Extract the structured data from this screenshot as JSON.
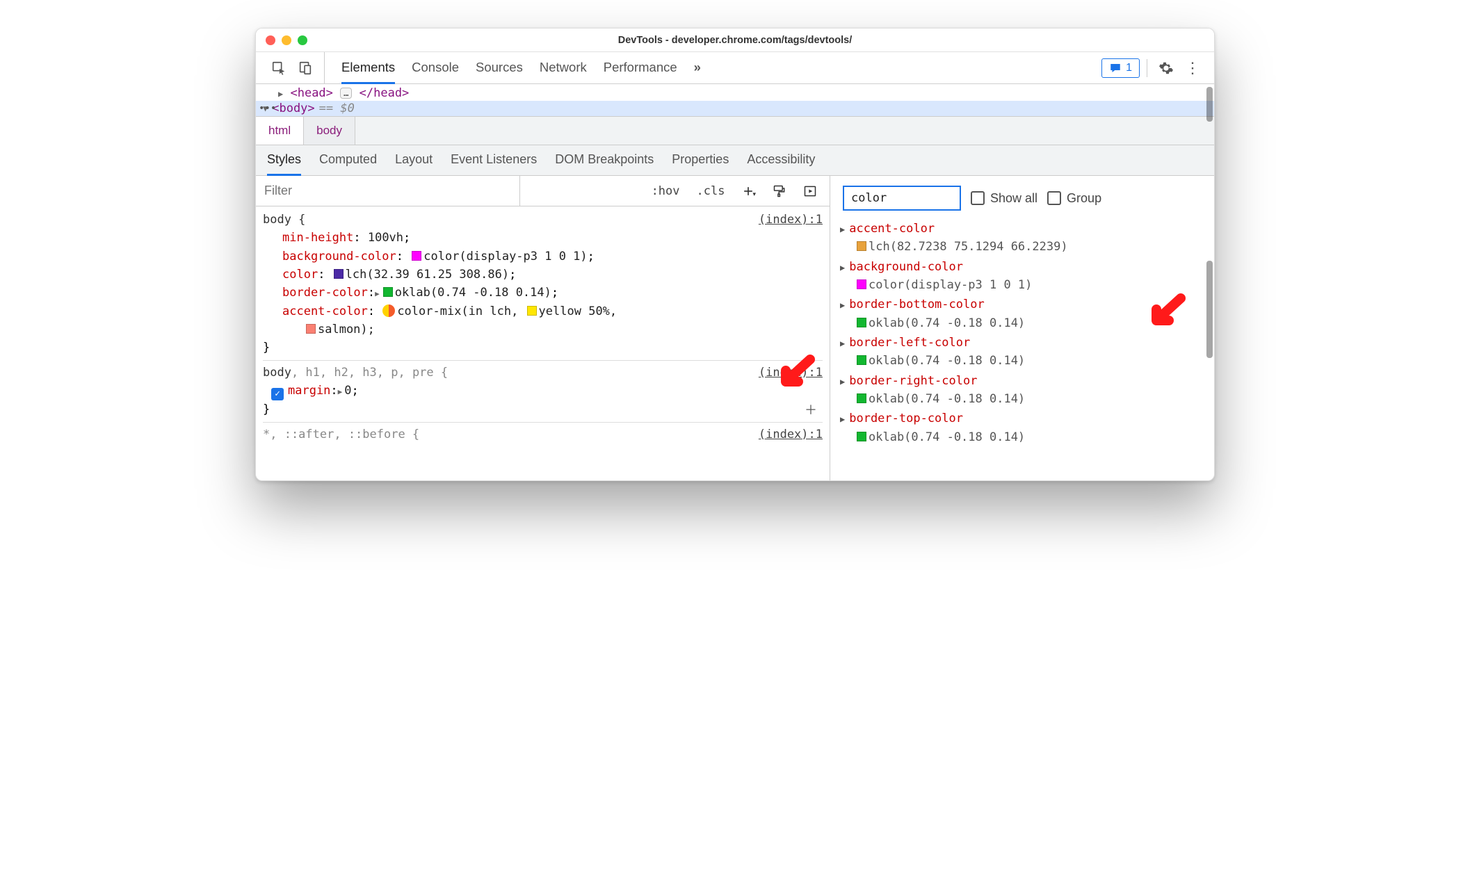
{
  "window": {
    "title": "DevTools - developer.chrome.com/tags/devtools/"
  },
  "main_tabs": [
    "Elements",
    "Console",
    "Sources",
    "Network",
    "Performance"
  ],
  "main_tabs_active": "Elements",
  "overflow_symbol": "»",
  "issues_count": "1",
  "dom": {
    "head_open": "<head>",
    "head_close": "</head>",
    "ellipsis": "…",
    "body_open": "<body>",
    "eqdollar": "== $0"
  },
  "breadcrumbs": [
    "html",
    "body"
  ],
  "sub_tabs": [
    "Styles",
    "Computed",
    "Layout",
    "Event Listeners",
    "DOM Breakpoints",
    "Properties",
    "Accessibility"
  ],
  "sub_tabs_active": "Styles",
  "filter": {
    "placeholder": "Filter",
    "hov": ":hov",
    "cls": ".cls"
  },
  "styles": {
    "rule1": {
      "selector": "body {",
      "source": "(index):1",
      "p1_name": "min-height",
      "p1_val": "100vh",
      "p2_name": "background-color",
      "p2_val": "color(display-p3 1 0 1)",
      "p3_name": "color",
      "p3_val": "lch(32.39 61.25 308.86)",
      "p4_name": "border-color",
      "p4_val": "oklab(0.74 -0.18 0.14)",
      "p5_name": "accent-color",
      "p5_val_a": "color-mix(in lch, ",
      "p5_val_yellow": "yellow",
      "p5_val_pct": " 50%,",
      "p5_cont": "salmon);",
      "close": "}"
    },
    "rule2": {
      "selector_main": "body",
      "selector_rest": ", h1, h2, h3, p, pre {",
      "source": "(index):1",
      "p1_name": "margin",
      "p1_val": "0",
      "close": "}"
    },
    "rule3": {
      "selector": "*, ::after, ::before {",
      "source": "(index):1"
    }
  },
  "computed": {
    "filter_value": "color",
    "show_all": "Show all",
    "group": "Group",
    "rows": [
      {
        "name": "accent-color",
        "swatch": "sw-orange",
        "value": "lch(82.7238 75.1294 66.2239)"
      },
      {
        "name": "background-color",
        "swatch": "sw-magenta",
        "value": "color(display-p3 1 0 1)"
      },
      {
        "name": "border-bottom-color",
        "swatch": "sw-green",
        "value": "oklab(0.74 -0.18 0.14)"
      },
      {
        "name": "border-left-color",
        "swatch": "sw-green",
        "value": "oklab(0.74 -0.18 0.14)"
      },
      {
        "name": "border-right-color",
        "swatch": "sw-green",
        "value": "oklab(0.74 -0.18 0.14)"
      },
      {
        "name": "border-top-color",
        "swatch": "sw-green",
        "value": "oklab(0.74 -0.18 0.14)"
      }
    ]
  }
}
